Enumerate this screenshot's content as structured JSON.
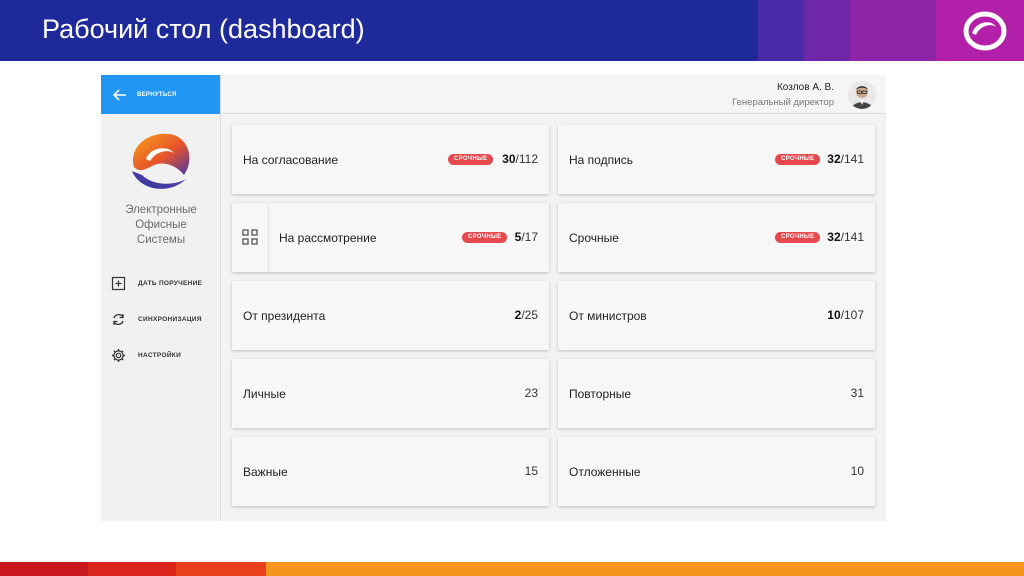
{
  "slide": {
    "title": "Рабочий стол (dashboard)"
  },
  "sidebar": {
    "back_label": "ВЕРНУТЬСЯ",
    "brand_lines": [
      "Электронные",
      "Офисные",
      "Системы"
    ],
    "menu": [
      {
        "label": "ДАТЬ ПОРУЧЕНИЕ",
        "icon": "add-task-icon"
      },
      {
        "label": "СИНХРОНИЗАЦИЯ",
        "icon": "sync-icon"
      },
      {
        "label": "НАСТРОЙКИ",
        "icon": "gear-icon"
      }
    ]
  },
  "header": {
    "user_name": "Козлов А. В.",
    "user_role": "Генеральный директор"
  },
  "badge_label": "СРОЧНЫЕ",
  "cards": [
    {
      "title": "На согласование",
      "urgent": true,
      "bold": "30",
      "total": "/112"
    },
    {
      "title": "На подпись",
      "urgent": true,
      "bold": "32",
      "total": "/141"
    },
    {
      "title": "На рассмотрение",
      "urgent": true,
      "bold": "5",
      "total": "/17"
    },
    {
      "title": "Срочные",
      "urgent": true,
      "bold": "32",
      "total": "/141"
    },
    {
      "title": "От президента",
      "urgent": false,
      "bold": "2",
      "total": "/25"
    },
    {
      "title": "От министров",
      "urgent": false,
      "bold": "10",
      "total": "/107"
    },
    {
      "title": "Личные",
      "urgent": false,
      "bold": "",
      "total": "23"
    },
    {
      "title": "Повторные",
      "urgent": false,
      "bold": "",
      "total": "31"
    },
    {
      "title": "Важные",
      "urgent": false,
      "bold": "",
      "total": "15"
    },
    {
      "title": "Отложенные",
      "urgent": false,
      "bold": "",
      "total": "10"
    }
  ],
  "colors": {
    "accent": "#2196f3",
    "badge": "#e5484d",
    "banner": "#1e2a9a"
  }
}
